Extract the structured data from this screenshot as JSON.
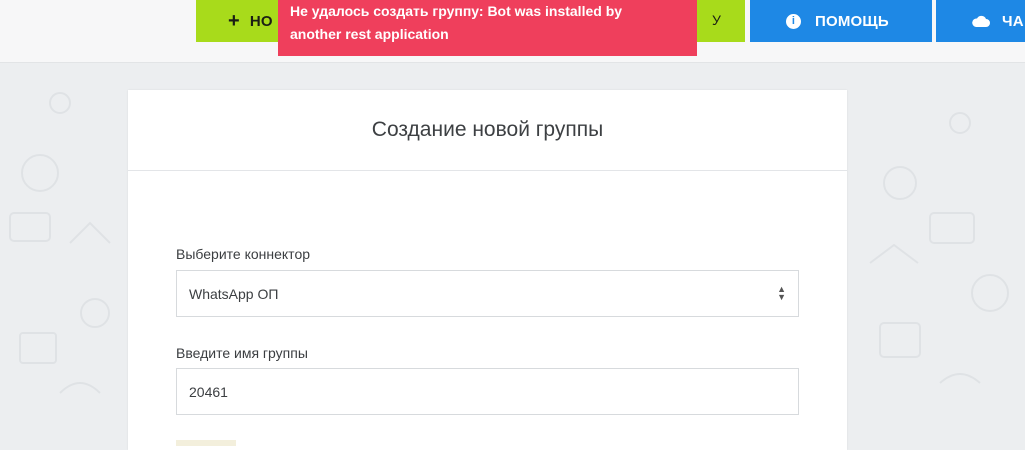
{
  "header": {
    "new_button": {
      "label": "НО",
      "tail": "У",
      "icon": "plus-icon"
    },
    "help_button": {
      "label": "ПОМОЩЬ",
      "icon": "info-icon"
    },
    "chat_button": {
      "label": "ЧА",
      "icon": "cloud-icon"
    }
  },
  "toast": {
    "line1": "Не удалось создать группу: Bot was installed by",
    "line2": "another rest application",
    "color": "#ef3f5c"
  },
  "form": {
    "title": "Создание новой группы",
    "connector": {
      "label": "Выберите коннектор",
      "value": "WhatsApp ОП"
    },
    "group_name": {
      "label": "Введите имя группы",
      "value": "20461"
    }
  },
  "colors": {
    "green": "#a8db1b",
    "blue": "#1e88e5"
  }
}
